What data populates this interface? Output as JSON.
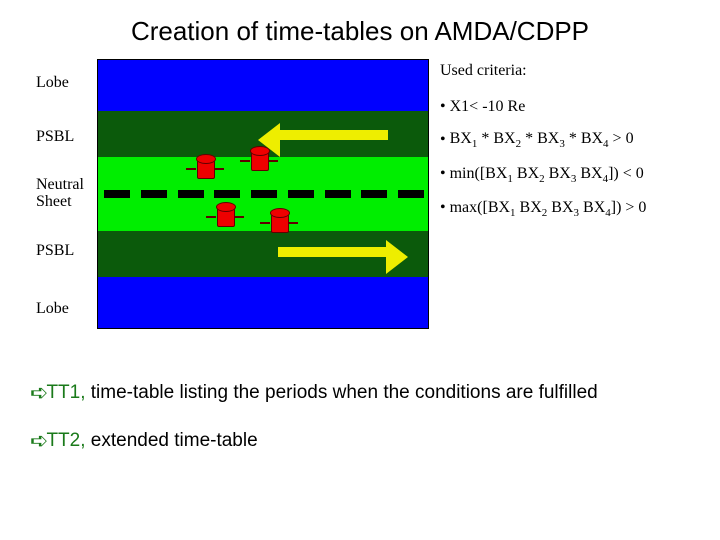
{
  "title": "Creation of time-tables on AMDA/CDPP",
  "labels": {
    "lobe_top": "Lobe",
    "psbl_top": "PSBL",
    "neutral_1": "Neutral",
    "neutral_2": "Sheet",
    "psbl_bot": "PSBL",
    "lobe_bot": "Lobe"
  },
  "criteria": {
    "heading": "Used criteria:",
    "items": [
      {
        "bullet": "•",
        "parts": [
          "X1< -10 Re"
        ]
      },
      {
        "bullet": "•",
        "parts": [
          "BX",
          "1",
          " * BX",
          "2",
          " * BX",
          "3",
          " * BX",
          "4",
          " > 0"
        ]
      },
      {
        "bullet": "•",
        "parts": [
          "min([BX",
          "1",
          "  BX",
          "2",
          "  BX",
          "3",
          "  BX",
          "4",
          "]) < 0"
        ]
      },
      {
        "bullet": "•",
        "parts": [
          "max([BX",
          "1",
          "  BX",
          "2",
          "  BX",
          "3",
          "  BX",
          "4",
          "]) > 0"
        ]
      }
    ]
  },
  "notes": {
    "bullet_glyph": "➪",
    "tt1_label": "TT1, ",
    "tt1_rest": "time-table listing the periods when the conditions are fulfilled",
    "tt2_label": "TT2, ",
    "tt2_rest": "extended time-table"
  }
}
